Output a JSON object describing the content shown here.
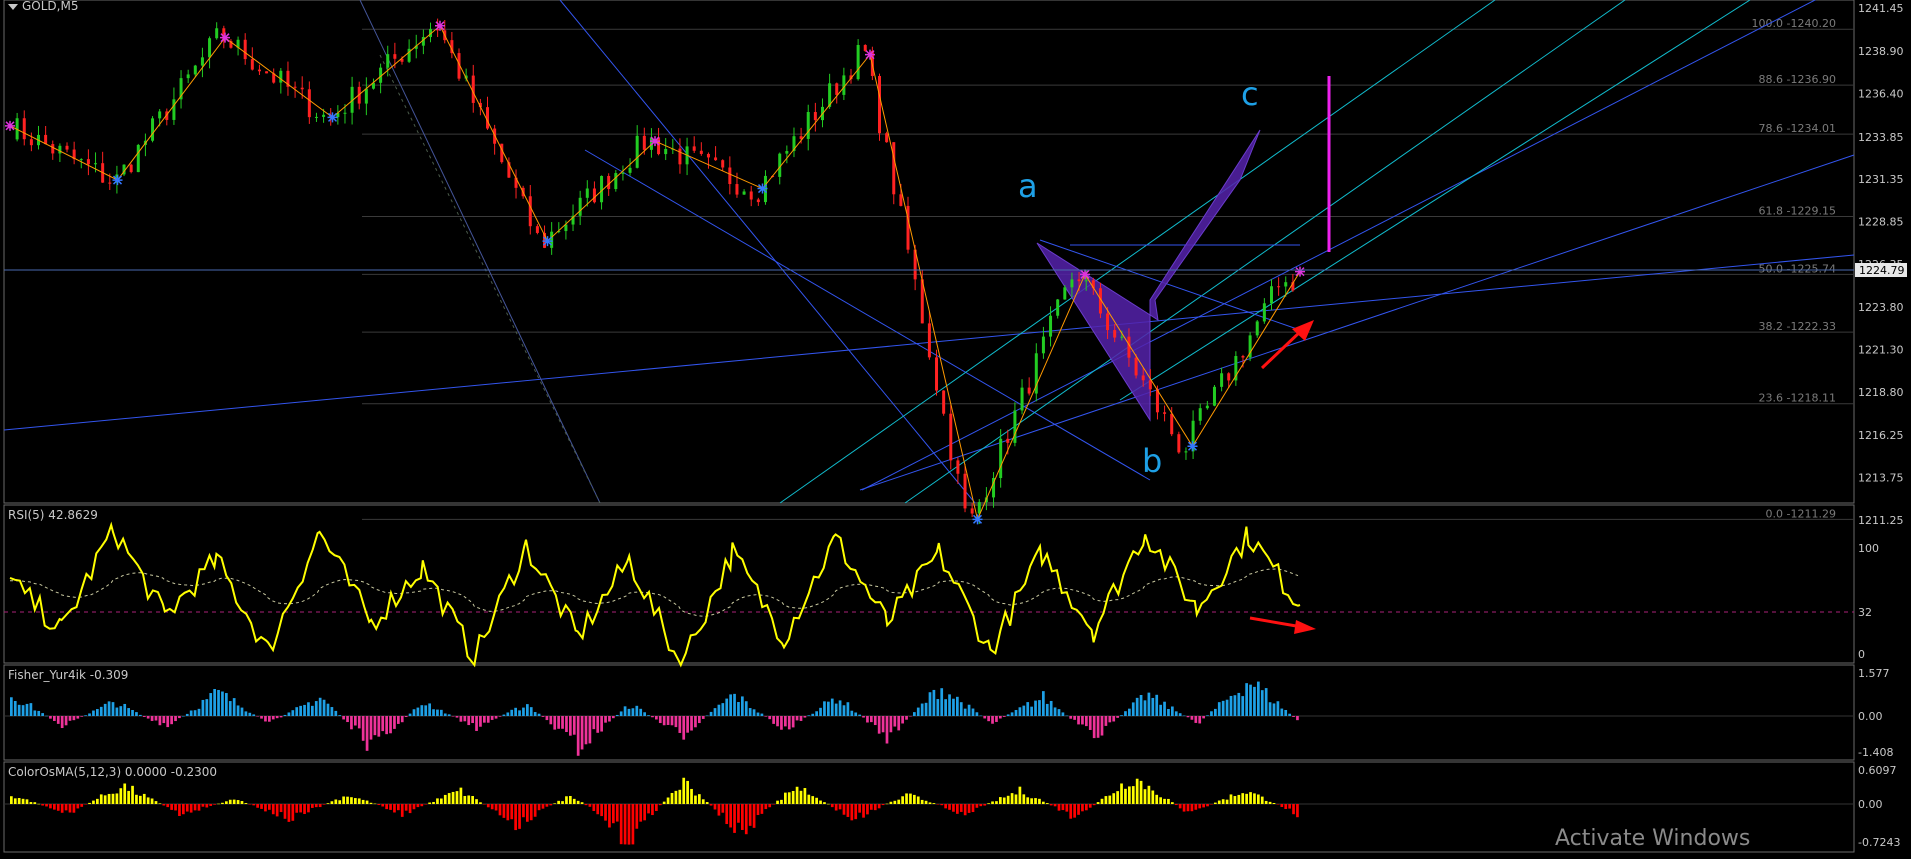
{
  "window": {
    "symbol_label": "GOLD,M5",
    "watermark": "Activate Windows"
  },
  "colors": {
    "background": "#000000",
    "grid": "#303030",
    "bull_candle": "#22cc22",
    "bear_candle": "#ff2222",
    "zigzag": "#ff9900",
    "channel_blue": "#3355ee",
    "channel_cyan": "#11bbcc",
    "pattern_fill": "#5522aa",
    "target_line": "#ee22ee",
    "wave_label": "#1ea0e6",
    "rsi_line": "#ffff00",
    "fisher_pos": "#1ea0e6",
    "fisher_neg": "#ee3399",
    "osma_pos": "#ffff00",
    "osma_neg": "#ff0000",
    "arrow": "#ff1111"
  },
  "main": {
    "price_axis": [
      "1241.45",
      "1238.90",
      "1236.40",
      "1233.85",
      "1231.35",
      "1228.85",
      "1226.35",
      "1223.80",
      "1221.30",
      "1218.80",
      "1216.25",
      "1213.75",
      "1211.25"
    ],
    "current_price": "1224.79",
    "fib_levels": [
      {
        "label": "100.0 -1240.20",
        "price": 1240.2
      },
      {
        "label": "88.6 -1236.90",
        "price": 1236.9
      },
      {
        "label": "78.6 -1234.01",
        "price": 1234.01
      },
      {
        "label": "61.8 -1229.15",
        "price": 1229.15
      },
      {
        "label": "50.0 -1225.74",
        "price": 1225.74
      },
      {
        "label": "38.2 -1222.33",
        "price": 1222.33
      },
      {
        "label": "23.6 -1218.11",
        "price": 1218.11
      },
      {
        "label": "0.0 -1211.29",
        "price": 1211.29
      }
    ],
    "wave_labels": [
      "a",
      "b",
      "c"
    ]
  },
  "indicators": {
    "rsi": {
      "title": "RSI(5) 42.8629",
      "axis": [
        "100",
        "32",
        "0"
      ]
    },
    "fisher": {
      "title": "Fisher_Yur4ik -0.309",
      "axis": [
        "1.577",
        "0.00",
        "-1.408"
      ]
    },
    "osma": {
      "title": "ColorOsMA(5,12,3) 0.0000 -0.2300",
      "axis": [
        "0.6097",
        "0.00",
        "-0.7243"
      ]
    }
  },
  "chart_data": [
    {
      "type": "candlestick",
      "title": "GOLD,M5",
      "ylim": [
        1211.25,
        1241.45
      ],
      "yticks": [
        1241.45,
        1238.9,
        1236.4,
        1233.85,
        1231.35,
        1228.85,
        1226.35,
        1223.8,
        1221.3,
        1218.8,
        1216.25,
        1213.75,
        1211.25
      ],
      "pivots": [
        1234.5,
        1231.3,
        1239.7,
        1235.0,
        1240.4,
        1227.7,
        1233.6,
        1230.8,
        1238.7,
        1211.29,
        1225.74,
        1215.6,
        1225.9
      ],
      "last_price": 1224.79,
      "wave_points": [
        "a",
        "b",
        "c"
      ]
    },
    {
      "type": "line",
      "title": "RSI(5) 42.8629",
      "ylim": [
        0,
        100
      ],
      "level": 32,
      "pivots": [
        60,
        25,
        98,
        35,
        75,
        10,
        95,
        30,
        70,
        5,
        85,
        20,
        75,
        0,
        80,
        20,
        90,
        30,
        80,
        10,
        80,
        25,
        95,
        40,
        93,
        42.86
      ]
    },
    {
      "type": "bar",
      "title": "Fisher_Yur4ik -0.309",
      "ylim": [
        -1.408,
        1.577
      ],
      "pivots": [
        0.9,
        -0.4,
        0.6,
        -0.5,
        1.0,
        -0.3,
        0.8,
        -1.3,
        0.6,
        -0.5,
        0.5,
        -1.3,
        0.5,
        -0.8,
        0.9,
        -0.6,
        0.8,
        -0.9,
        1.2,
        -0.3,
        0.8,
        -0.9,
        0.9,
        -0.3,
        1.5,
        -0.309
      ]
    },
    {
      "type": "bar",
      "title": "ColorOsMA(5,12,3) 0.0000 -0.2300",
      "ylim": [
        -0.7243,
        0.6097
      ],
      "pivots": [
        0.2,
        -0.2,
        0.4,
        -0.2,
        0.1,
        -0.3,
        0.2,
        -0.2,
        0.3,
        -0.4,
        0.2,
        -0.7,
        0.5,
        -0.6,
        0.4,
        -0.3,
        0.2,
        -0.2,
        0.3,
        -0.3,
        0.6,
        -0.2,
        0.3,
        -0.23
      ]
    }
  ]
}
